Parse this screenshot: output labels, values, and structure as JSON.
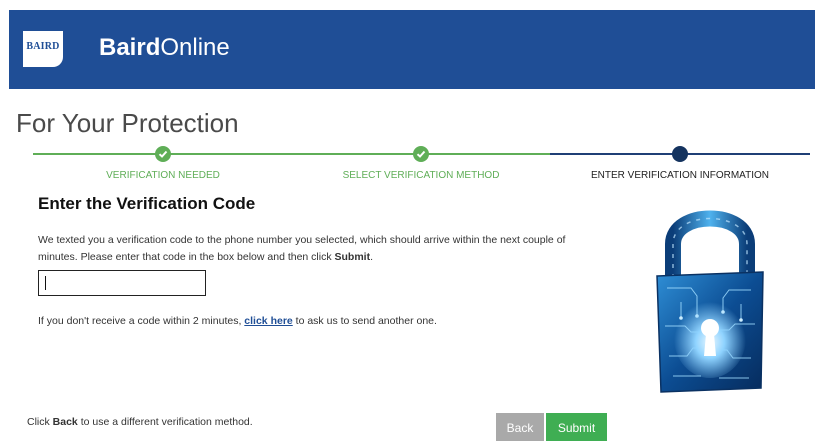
{
  "header": {
    "logo_text": "BAIRD",
    "brand_bold": "Baird",
    "brand_light": "Online"
  },
  "page": {
    "title": "For Your Protection"
  },
  "steps": [
    {
      "label": "VERIFICATION NEEDED",
      "status": "complete"
    },
    {
      "label": "SELECT VERIFICATION METHOD",
      "status": "complete"
    },
    {
      "label": "ENTER VERIFICATION INFORMATION",
      "status": "current"
    }
  ],
  "form": {
    "heading": "Enter the Verification Code",
    "instruction_pre": "We texted you a verification code to the phone number you selected, which should arrive within the next couple of minutes. Please enter that code in the box below and then click ",
    "instruction_strong": "Submit",
    "instruction_post": ".",
    "code_value": "",
    "resend_pre": "If you don't receive a code within 2 minutes, ",
    "resend_link": "click here",
    "resend_post": " to ask us to send another one."
  },
  "footer": {
    "back_note_pre": "Click ",
    "back_note_strong": "Back",
    "back_note_post": " to use a different verification method.",
    "back_label": "Back",
    "submit_label": "Submit"
  },
  "colors": {
    "header_bg": "#1f4e96",
    "complete_green": "#5fae57",
    "current_navy": "#14335f",
    "submit_green": "#3fae53",
    "back_gray": "#a9a9a9"
  },
  "icons": {
    "lock": "padlock-circuit-icon",
    "check": "checkmark-icon"
  }
}
